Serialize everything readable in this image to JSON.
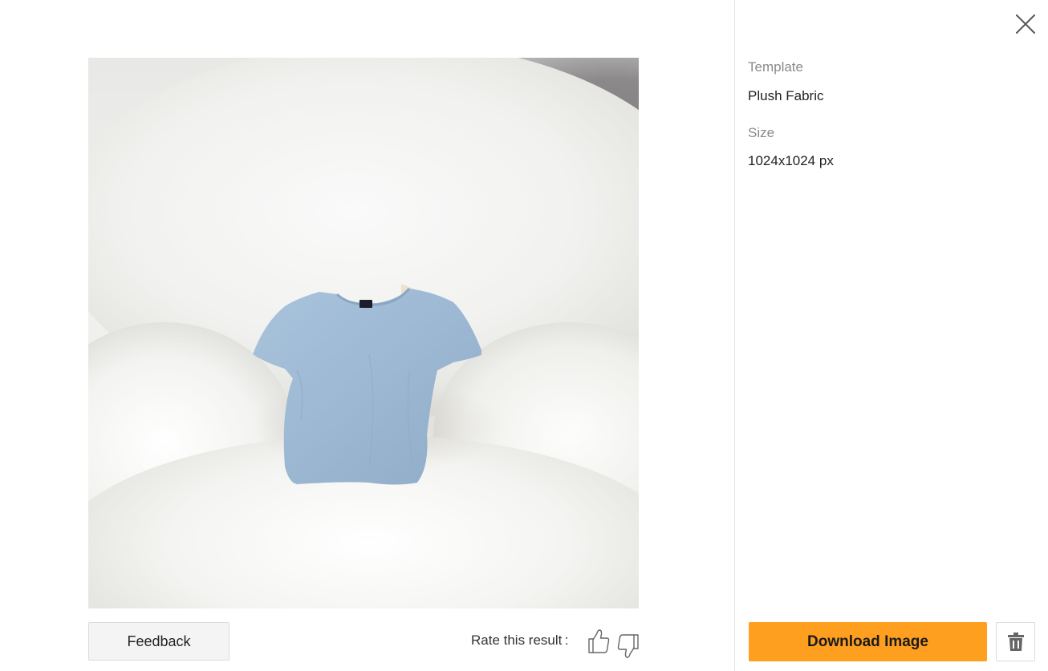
{
  "preview": {
    "alt": "Blue t-shirt on plush white fabric"
  },
  "footer": {
    "feedback_label": "Feedback",
    "rate_label": "Rate this result :"
  },
  "details": {
    "template_label": "Template",
    "template_value": "Plush Fabric",
    "size_label": "Size",
    "size_value": "1024x1024 px"
  },
  "actions": {
    "download_label": "Download Image"
  },
  "icons": {
    "close": "close-icon",
    "thumbs_up": "thumbs-up-icon",
    "thumbs_down": "thumbs-down-icon",
    "delete": "trash-icon"
  },
  "colors": {
    "accent": "#ff9f1f",
    "divider": "#e6e6e6",
    "muted_text": "#8a8a8a"
  }
}
